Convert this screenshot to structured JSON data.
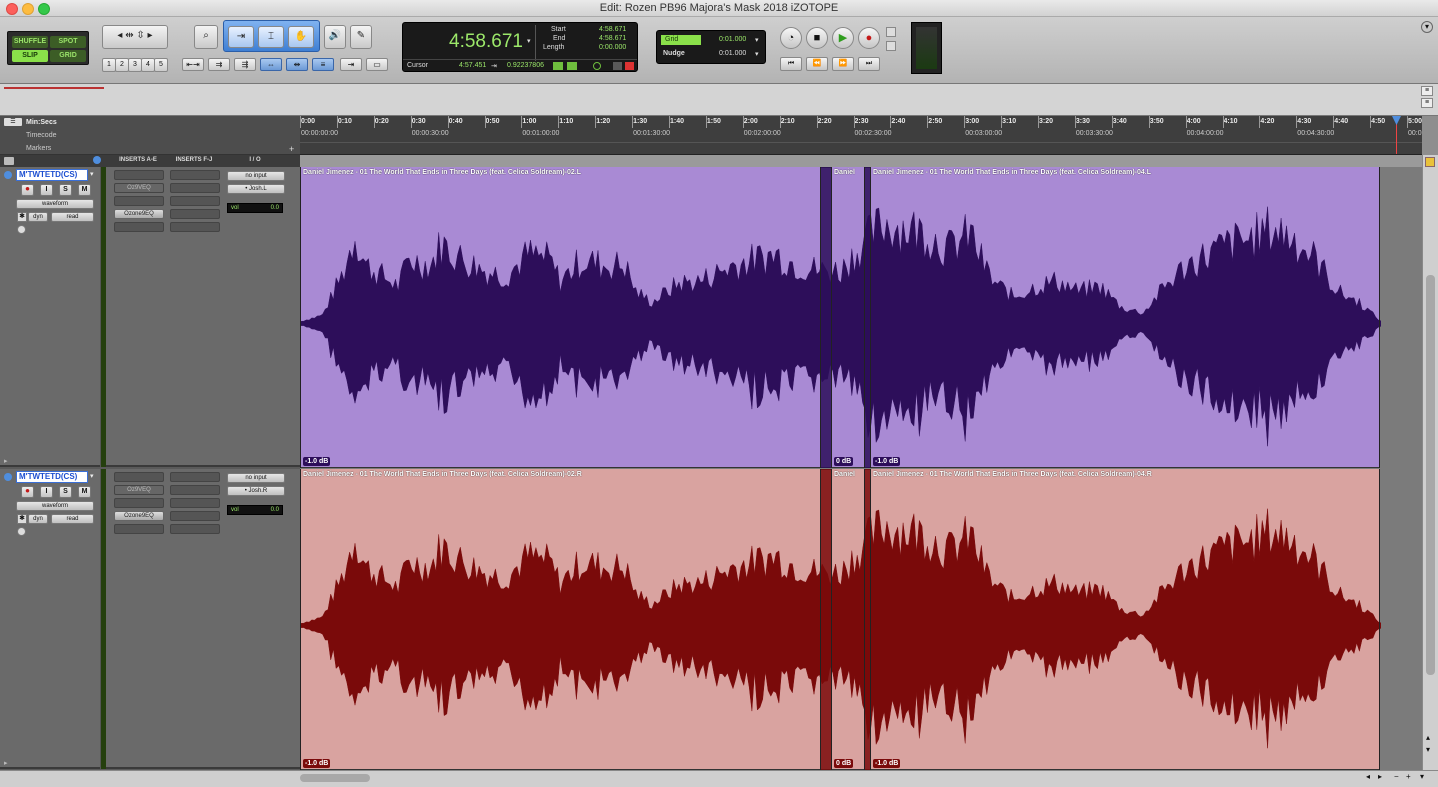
{
  "window": {
    "title": "Edit: Rozen PB96 Majora's Mask 2018 iZOTOPE"
  },
  "edit_modes": {
    "shuffle": "SHUFFLE",
    "spot": "SPOT",
    "slip": "SLIP",
    "grid": "GRID"
  },
  "zoom_presets": [
    "1",
    "2",
    "3",
    "4",
    "5"
  ],
  "counter": {
    "main": "4:58.671",
    "start_label": "Start",
    "start": "4:58.671",
    "end_label": "End",
    "end": "4:58.671",
    "length_label": "Length",
    "length": "0:00.000",
    "cursor_label": "Cursor",
    "cursor": "4:57.451",
    "sample_value": "0.92237806"
  },
  "grid_nudge": {
    "grid_label": "Grid",
    "grid_value": "0:01.000",
    "nudge_label": "Nudge",
    "nudge_value": "0:01.000"
  },
  "rulers": {
    "minsecs": "Min:Secs",
    "timecode": "Timecode",
    "markers": "Markers"
  },
  "minsecs_ticks": [
    "0:00",
    "0:10",
    "0:20",
    "0:30",
    "0:40",
    "0:50",
    "1:00",
    "1:10",
    "1:20",
    "1:30",
    "1:40",
    "1:50",
    "2:00",
    "2:10",
    "2:20",
    "2:30",
    "2:40",
    "2:50",
    "3:00",
    "3:10",
    "3:20",
    "3:30",
    "3:40",
    "3:50",
    "4:00",
    "4:10",
    "4:20",
    "4:30",
    "4:40",
    "4:50",
    "5:00"
  ],
  "timecode_ticks": [
    "00:00:00:00",
    "00:00:30:00",
    "00:01:00:00",
    "00:01:30:00",
    "00:02:00:00",
    "00:02:30:00",
    "00:03:00:00",
    "00:03:30:00",
    "00:04:00:00",
    "00:04:30:00",
    "00:0"
  ],
  "columns": {
    "inserts_ae": "INSERTS A-E",
    "inserts_fj": "INSERTS F-J",
    "io": "I / O"
  },
  "tracks": [
    {
      "name": "M'TWTETD(CS)",
      "buttons": [
        "⏺",
        "I",
        "S",
        "M"
      ],
      "view": "waveform",
      "automation_dyn": "dyn",
      "automation_mode": "read",
      "inserts_ae": [
        "",
        "Oz9VEQ",
        "",
        "Ozone9EQ",
        ""
      ],
      "input": "no input",
      "output": "• Josh.L",
      "vol_label": "vol",
      "vol_value": "0.0",
      "color": "#a98ad4",
      "wave_color": "#2d0e5a",
      "clips": [
        {
          "name": "Daniel Jimenez - 01 The World That Ends in Three Days (feat. Celica Soldream)-02.L",
          "gain": "-1.0 dB"
        },
        {
          "name": "Daniel",
          "gain": "0 dB"
        },
        {
          "name": "Daniel Jimenez - 01 The World That Ends in Three Days (feat. Celica Soldream)-04.L",
          "gain": "-1.0 dB"
        }
      ]
    },
    {
      "name": "M'TWTETD(CS)",
      "buttons": [
        "⏺",
        "I",
        "S",
        "M"
      ],
      "view": "waveform",
      "automation_dyn": "dyn",
      "automation_mode": "read",
      "inserts_ae": [
        "",
        "Oz9VEQ",
        "",
        "Ozone9EQ",
        ""
      ],
      "input": "no input",
      "output": "• Josh.R",
      "vol_label": "vol",
      "vol_value": "0.0",
      "color": "#d9a3a0",
      "wave_color": "#7a0a0a",
      "clips": [
        {
          "name": "Daniel Jimenez - 01 The World That Ends in Three Days (feat. Celica Soldream)-02.R",
          "gain": "-1.0 dB"
        },
        {
          "name": "Daniel",
          "gain": "0 dB"
        },
        {
          "name": "Daniel Jimenez - 01 The World That Ends in Three Days (feat. Celica Soldream)-04.R",
          "gain": "-1.0 dB"
        }
      ]
    }
  ]
}
